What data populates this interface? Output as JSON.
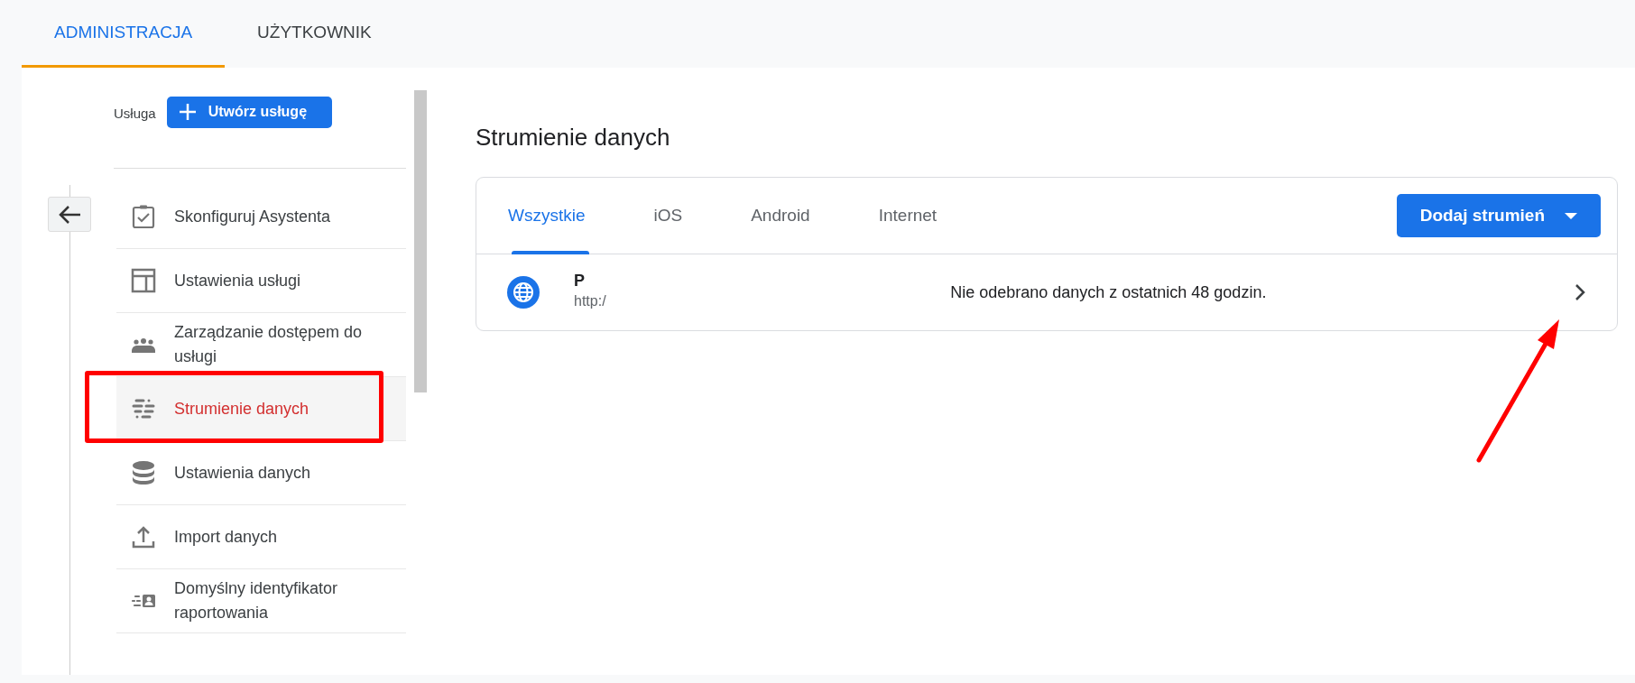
{
  "top_tabs": [
    {
      "label": "ADMINISTRACJA",
      "selected": true
    },
    {
      "label": "UŻYTKOWNIK",
      "selected": false
    }
  ],
  "property": {
    "label": "Usługa",
    "create_button": "Utwórz usługę"
  },
  "menu": [
    {
      "kind": "clipboard-check",
      "label": "Skonfiguruj Asystenta",
      "selected": false,
      "highlighted": false
    },
    {
      "kind": "layout",
      "label": "Ustawienia usługi",
      "selected": false,
      "highlighted": false
    },
    {
      "kind": "people",
      "label": "Zarządzanie dostępem do usługi",
      "selected": false,
      "highlighted": false
    },
    {
      "kind": "streams",
      "label": "Strumienie danych",
      "selected": true,
      "highlighted": true
    },
    {
      "kind": "database",
      "label": "Ustawienia danych",
      "selected": false,
      "highlighted": false
    },
    {
      "kind": "upload",
      "label": "Import danych",
      "selected": false,
      "highlighted": false
    },
    {
      "kind": "id-card",
      "label": "Domyślny identyfikator raportowania",
      "selected": false,
      "highlighted": false
    }
  ],
  "page_title": "Strumienie danych",
  "stream_tabs": [
    {
      "label": "Wszystkie",
      "selected": true
    },
    {
      "label": "iOS",
      "selected": false
    },
    {
      "label": "Android",
      "selected": false
    },
    {
      "label": "Internet",
      "selected": false
    }
  ],
  "add_button": "Dodaj strumień",
  "streams": [
    {
      "name": "P",
      "url": "http:/",
      "status": "Nie odebrano danych z ostatnich 48 godzin.",
      "arrow_annotation": true
    }
  ]
}
